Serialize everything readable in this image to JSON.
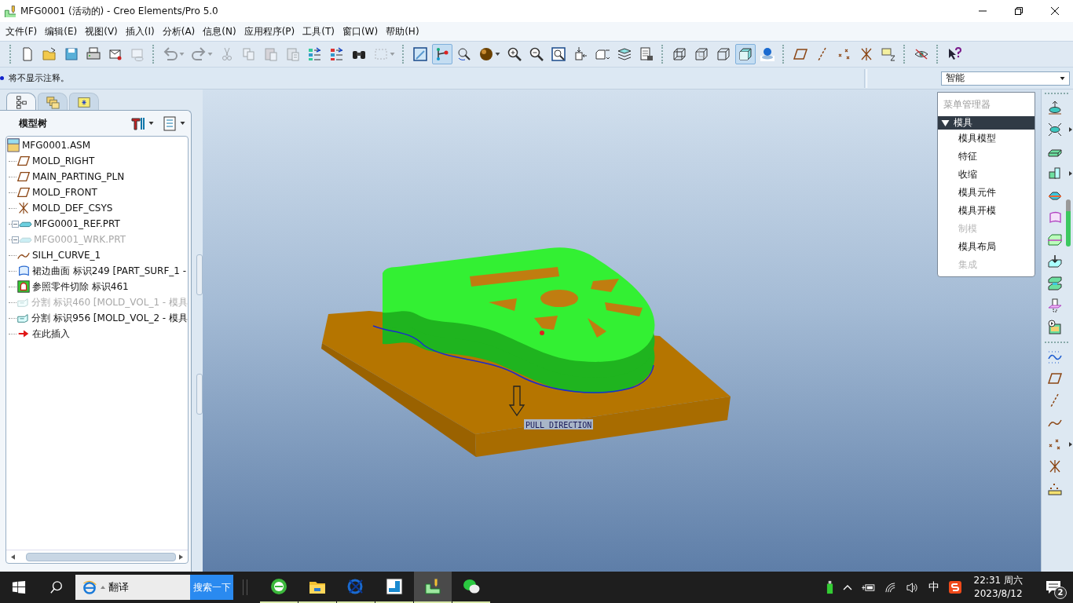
{
  "window": {
    "title": "MFG0001 (活动的) - Creo Elements/Pro 5.0"
  },
  "menu": [
    "文件(F)",
    "编辑(E)",
    "视图(V)",
    "插入(I)",
    "分析(A)",
    "信息(N)",
    "应用程序(P)",
    "工具(T)",
    "窗口(W)",
    "帮助(H)"
  ],
  "toolbar": [
    [
      {
        "selected": false,
        "disabled": false
      },
      {
        "selected": false,
        "disabled": false
      },
      {
        "selected": false,
        "disabled": false
      },
      {
        "selected": false,
        "disabled": false
      },
      {
        "selected": false,
        "disabled": false
      },
      {
        "selected": false,
        "disabled": true
      }
    ],
    [
      {
        "selected": false,
        "disabled": true
      },
      {
        "selected": false,
        "disabled": true
      },
      {
        "selected": false,
        "disabled": true
      },
      {
        "selected": false,
        "disabled": true
      },
      {
        "selected": false,
        "disabled": true
      },
      {
        "selected": false,
        "disabled": true
      },
      {
        "selected": false,
        "disabled": false
      },
      {
        "selected": false,
        "disabled": false
      },
      {
        "selected": false,
        "disabled": false
      },
      {
        "selected": false,
        "disabled": true
      }
    ],
    [
      {
        "selected": false,
        "disabled": false
      },
      {
        "selected": true,
        "disabled": false
      },
      {
        "selected": false,
        "disabled": false
      },
      {
        "selected": false,
        "disabled": false
      },
      {
        "selected": false,
        "disabled": false
      },
      {
        "selected": false,
        "disabled": false
      },
      {
        "selected": false,
        "disabled": false
      },
      {
        "selected": false,
        "disabled": false
      },
      {
        "selected": false,
        "disabled": false
      },
      {
        "selected": false,
        "disabled": false
      },
      {
        "selected": false,
        "disabled": false
      }
    ],
    [
      {
        "selected": false,
        "disabled": false
      },
      {
        "selected": false,
        "disabled": false
      },
      {
        "selected": false,
        "disabled": false
      },
      {
        "selected": true,
        "disabled": false
      },
      {
        "selected": false,
        "disabled": false
      }
    ],
    [
      {
        "selected": false,
        "disabled": false
      },
      {
        "selected": false,
        "disabled": false
      },
      {
        "selected": false,
        "disabled": false
      },
      {
        "selected": false,
        "disabled": false
      },
      {
        "selected": false,
        "disabled": false
      }
    ],
    [
      {
        "selected": false,
        "disabled": false
      }
    ],
    [
      {
        "selected": false,
        "disabled": false
      }
    ]
  ],
  "message": "将不显示注释。",
  "filter": {
    "value": "智能"
  },
  "navigator": {
    "tabs": [
      {
        "selected": true
      },
      {
        "selected": false
      },
      {
        "selected": false
      }
    ],
    "title": "模型树",
    "tree": [
      {
        "label": "MFG0001.ASM",
        "kind": "assembly",
        "disabled": false,
        "children": [
          {
            "label": "MOLD_RIGHT",
            "kind": "plane",
            "disabled": false
          },
          {
            "label": "MAIN_PARTING_PLN",
            "kind": "plane",
            "disabled": false
          },
          {
            "label": "MOLD_FRONT",
            "kind": "plane",
            "disabled": false
          },
          {
            "label": "MOLD_DEF_CSYS",
            "kind": "csys",
            "disabled": false
          },
          {
            "label": "MFG0001_REF.PRT",
            "kind": "part",
            "disabled": false,
            "expanded": false
          },
          {
            "label": "MFG0001_WRK.PRT",
            "kind": "part",
            "disabled": true,
            "expanded": false
          },
          {
            "label": "SILH_CURVE_1",
            "kind": "curve",
            "disabled": false
          },
          {
            "label": "裙边曲面 标识249 [PART_SURF_1 -",
            "kind": "surface",
            "disabled": false
          },
          {
            "label": "参照零件切除 标识461",
            "kind": "cut",
            "disabled": false
          },
          {
            "label": "分割 标识460 [MOLD_VOL_1 - 模具",
            "kind": "split",
            "disabled": true
          },
          {
            "label": "分割 标识956 [MOLD_VOL_2 - 模具",
            "kind": "split",
            "disabled": false
          },
          {
            "label": "在此插入",
            "kind": "insert",
            "disabled": false
          }
        ]
      }
    ]
  },
  "viewport": {
    "pull_direction_label": "PULL DIRECTION"
  },
  "menu_manager": {
    "title": "菜单管理器",
    "section": {
      "label": "模具",
      "expanded": true,
      "items": [
        {
          "label": "模具模型",
          "disabled": false
        },
        {
          "label": "特征",
          "disabled": false
        },
        {
          "label": "收缩",
          "disabled": false
        },
        {
          "label": "模具元件",
          "disabled": false
        },
        {
          "label": "模具开模",
          "disabled": false
        },
        {
          "label": "制模",
          "disabled": true
        },
        {
          "label": "模具布局",
          "disabled": false
        },
        {
          "label": "集成",
          "disabled": true
        }
      ]
    }
  },
  "taskbar": {
    "search": {
      "value": "翻译"
    },
    "search_button": "搜索一下",
    "apps": [
      {
        "selected": false
      },
      {
        "selected": false
      },
      {
        "selected": false
      },
      {
        "selected": false
      },
      {
        "selected": true
      },
      {
        "selected": false
      }
    ],
    "ime": "中",
    "time": "22:31 周六",
    "date": "2023/8/12",
    "notifications": "2"
  }
}
